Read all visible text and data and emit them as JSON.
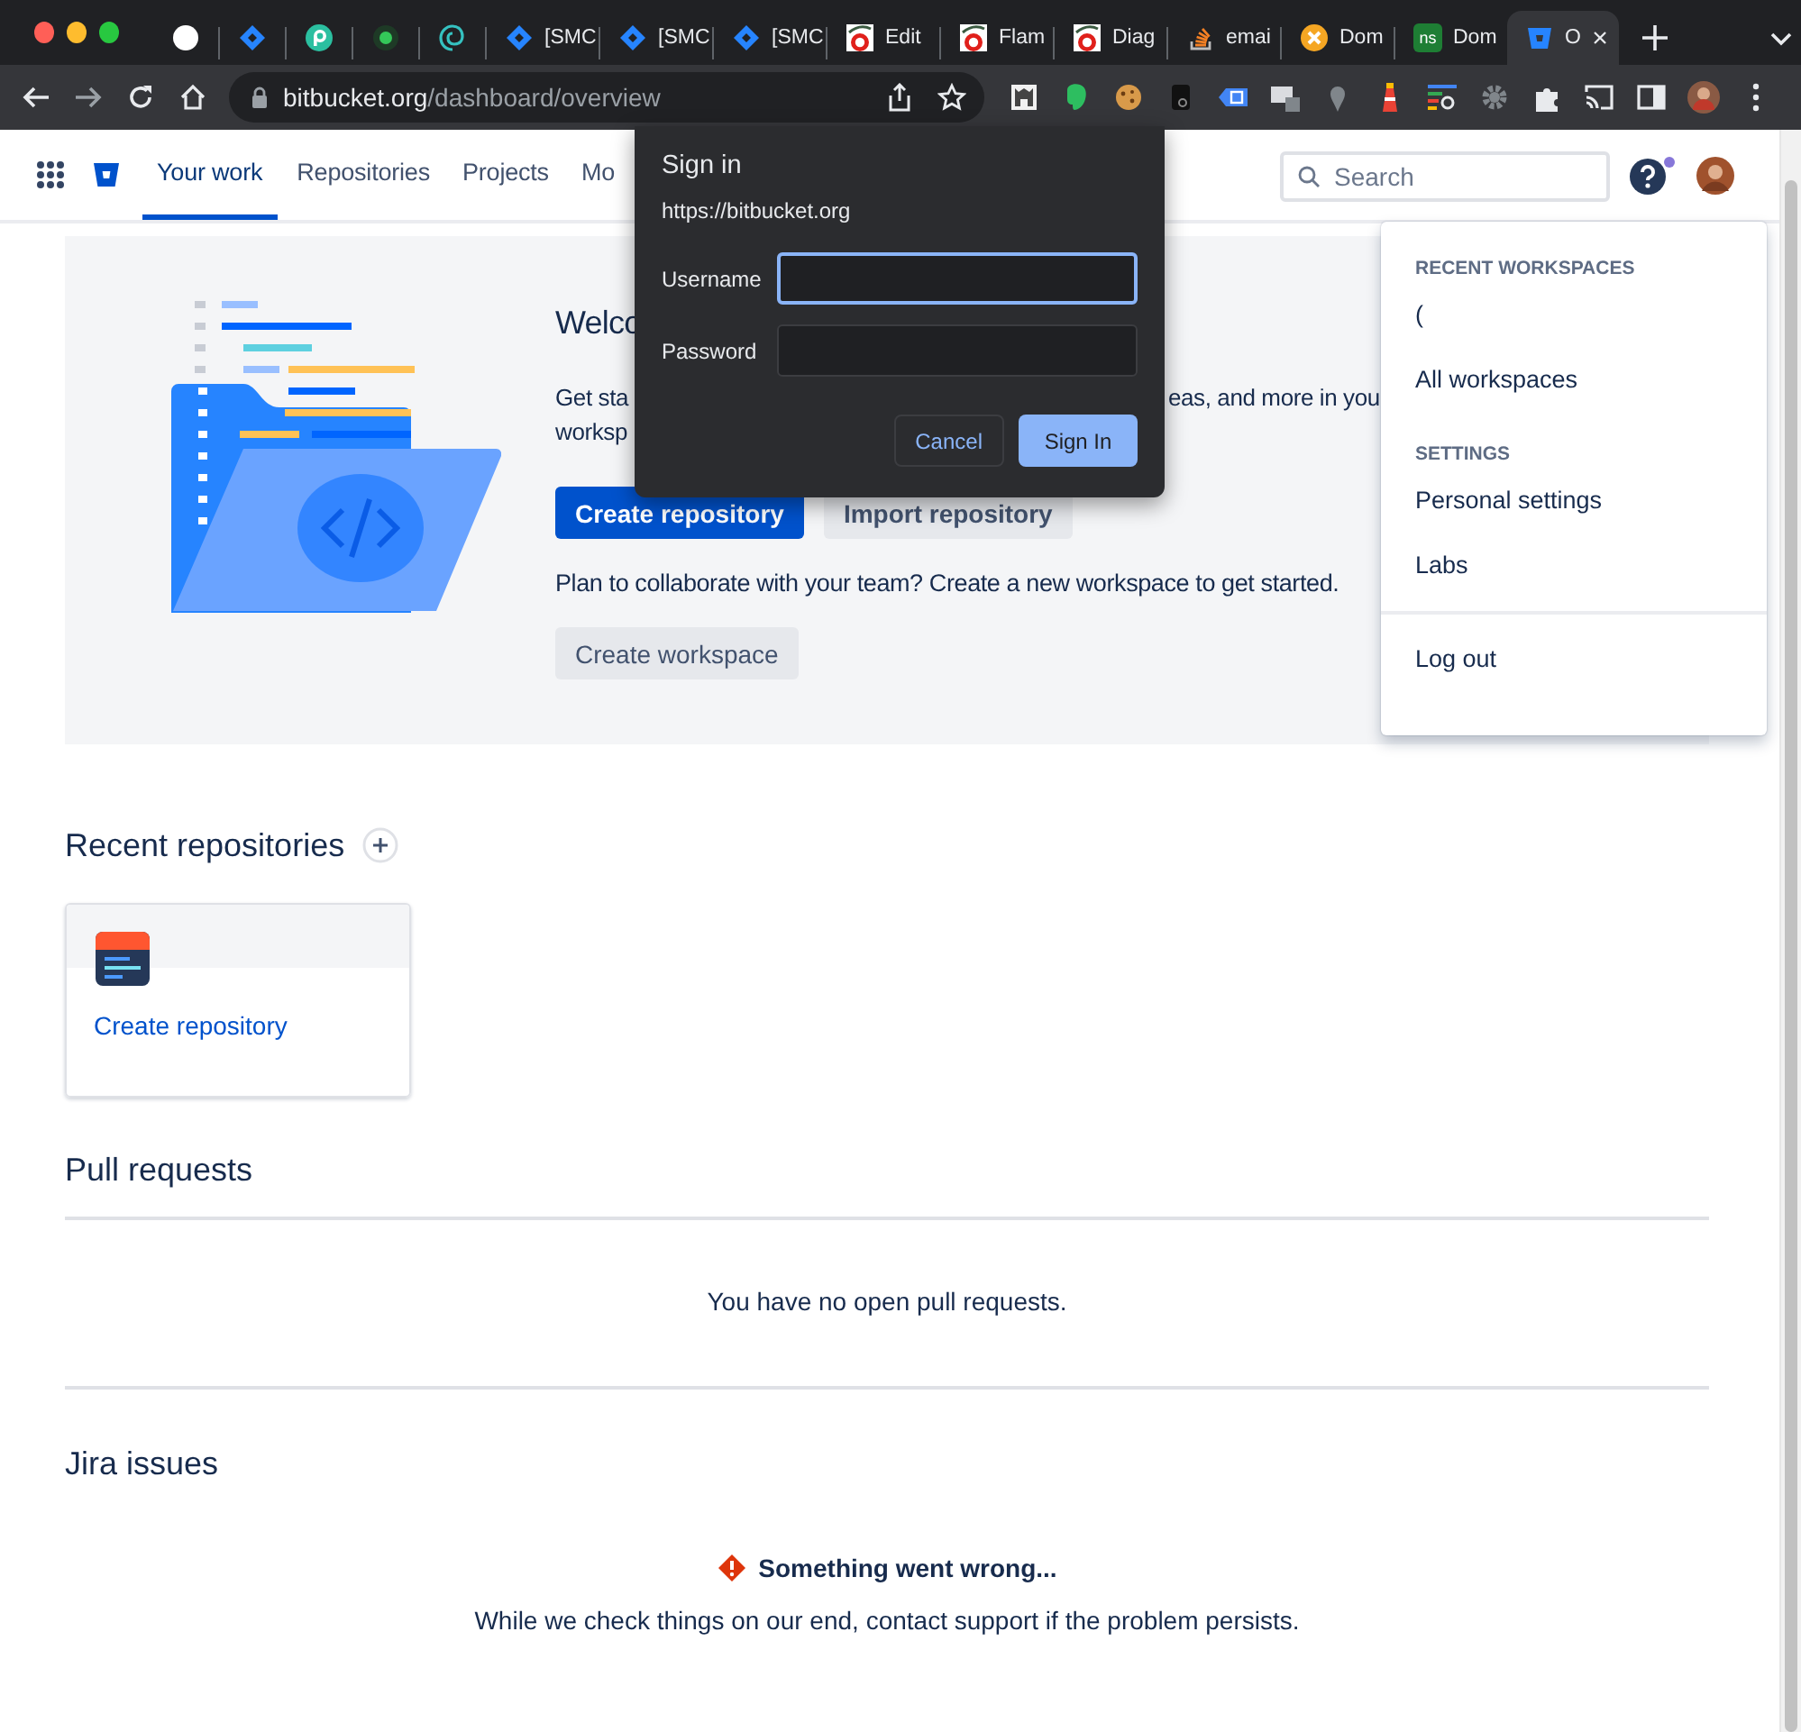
{
  "browser": {
    "tabs": [
      {
        "kind": "circle",
        "selected": false
      },
      {
        "kind": "jira",
        "selected": false
      },
      {
        "kind": "pcircle",
        "selected": false
      },
      {
        "kind": "dot",
        "selected": false
      },
      {
        "kind": "swirl",
        "selected": false
      },
      {
        "kind": "jira",
        "title": "[SMC",
        "selected": false
      },
      {
        "kind": "jira",
        "title": "[SMC",
        "selected": false
      },
      {
        "kind": "jira",
        "title": "[SMC",
        "selected": false
      },
      {
        "kind": "flame",
        "title": "Edit",
        "selected": false
      },
      {
        "kind": "flame",
        "title": "Flam",
        "selected": false
      },
      {
        "kind": "flame",
        "title": "Diag",
        "selected": false
      },
      {
        "kind": "stack",
        "title": "emai",
        "selected": false
      },
      {
        "kind": "xcircle",
        "title": "Dom",
        "selected": false
      },
      {
        "kind": "ns",
        "favicon_text": "ns",
        "title": "Dom",
        "selected": false
      },
      {
        "kind": "bitbucket",
        "title": "O",
        "selected": true
      }
    ],
    "address": {
      "host": "bitbucket.org",
      "path": "/dashboard/overview"
    }
  },
  "nav": {
    "items": [
      {
        "label": "Your work",
        "selected": true
      },
      {
        "label": "Repositories",
        "selected": false
      },
      {
        "label": "Projects",
        "selected": false
      },
      {
        "label": "Mo",
        "selected": false
      }
    ],
    "search": {
      "placeholder": "Search"
    },
    "help_notification": true
  },
  "welcome": {
    "heading": "Welco",
    "description_lines": [
      [
        "Get sta",
        "eas, and more in you"
      ],
      [
        "worksp"
      ]
    ],
    "buttons": [
      {
        "label": "Create repository",
        "kind": "primary"
      },
      {
        "label": "Import repository",
        "kind": "default"
      }
    ],
    "collaborate_text": "Plan to collaborate with your team? Create a new workspace to get started.",
    "workspace_button": "Create workspace"
  },
  "recent_repositories": {
    "title": "Recent repositories",
    "cards": [
      {
        "link": "Create repository"
      }
    ]
  },
  "pull_requests": {
    "title": "Pull requests",
    "empty_text": "You have no open pull requests."
  },
  "jira_issues": {
    "title": "Jira issues",
    "error_title": "Something went wrong...",
    "error_text": "While we check things on our end, contact support if the problem persists."
  },
  "sign_in_dialog": {
    "title": "Sign in",
    "origin": "https://bitbucket.org",
    "fields": [
      {
        "label": "Username",
        "focused": true
      },
      {
        "label": "Password",
        "focused": false
      }
    ],
    "buttons": [
      {
        "label": "Cancel",
        "kind": "secondary"
      },
      {
        "label": "Sign In",
        "kind": "primary"
      }
    ]
  },
  "account_menu": {
    "sections": [
      {
        "heading": "RECENT WORKSPACES",
        "items": [
          "(",
          "All workspaces"
        ]
      },
      {
        "heading": "SETTINGS",
        "items": [
          "Personal settings",
          "Labs"
        ]
      }
    ],
    "footer_items": [
      "Log out"
    ]
  }
}
